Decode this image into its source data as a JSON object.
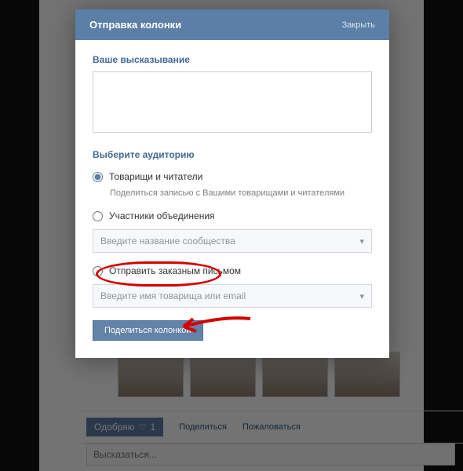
{
  "modal": {
    "title": "Отправка колонки",
    "close": "Закрыть",
    "statement_label": "Ваше высказывание",
    "audience_label": "Выберите аудиторию",
    "options": {
      "friends": {
        "label": "Товарищи и читатели",
        "hint": "Поделиться записью с Вашими товарищами и читателями"
      },
      "community": {
        "label": "Участники объединения",
        "placeholder": "Введите название сообщества"
      },
      "private": {
        "label": "Отправить заказным письмом",
        "placeholder": "Введите имя товарища или email"
      }
    },
    "submit": "Поделиться колонкой"
  },
  "footer": {
    "like_label": "Одобряю",
    "like_count": "1",
    "share": "Поделиться",
    "report": "Пожаловаться",
    "comment_placeholder": "Высказаться..."
  },
  "colors": {
    "accent": "#5b7fa6",
    "annotation": "#d40000"
  }
}
